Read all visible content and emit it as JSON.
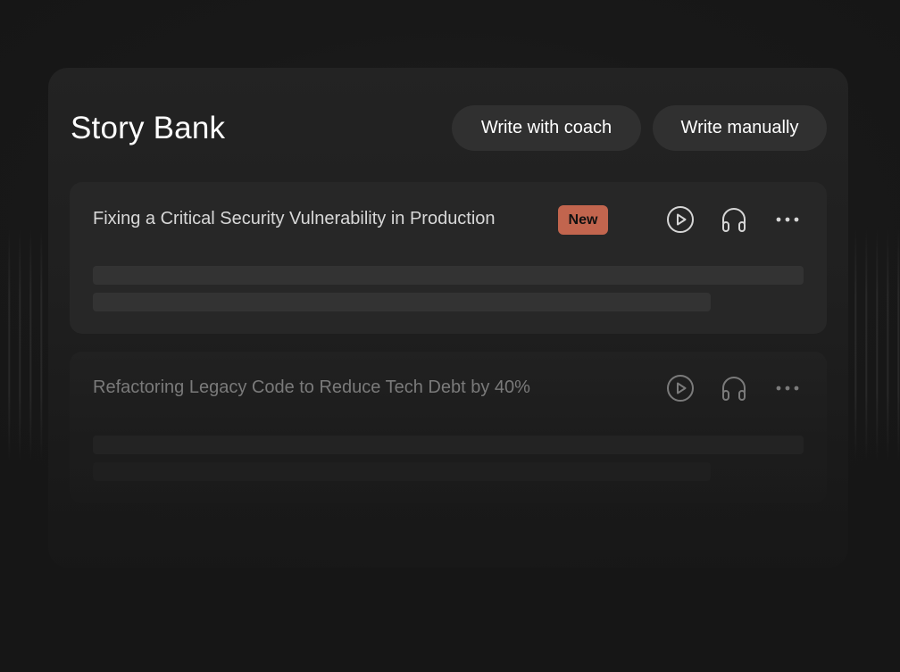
{
  "panel": {
    "title": "Story Bank",
    "buttons": {
      "coach_label": "Write with coach",
      "manual_label": "Write manually"
    }
  },
  "stories": [
    {
      "title": "Fixing a Critical Security Vulnerability in Production",
      "badge": "New",
      "icons": [
        "play-icon",
        "headphones-icon",
        "more-icon"
      ]
    },
    {
      "title": "Refactoring Legacy Code to Reduce Tech Debt by 40%",
      "icons": [
        "play-icon",
        "headphones-icon",
        "more-icon"
      ]
    }
  ],
  "colors": {
    "background": "#171717",
    "panel": "#232323",
    "card": "#272727",
    "button": "#303030",
    "badge": "#c2654e",
    "text": "#ffffff"
  }
}
